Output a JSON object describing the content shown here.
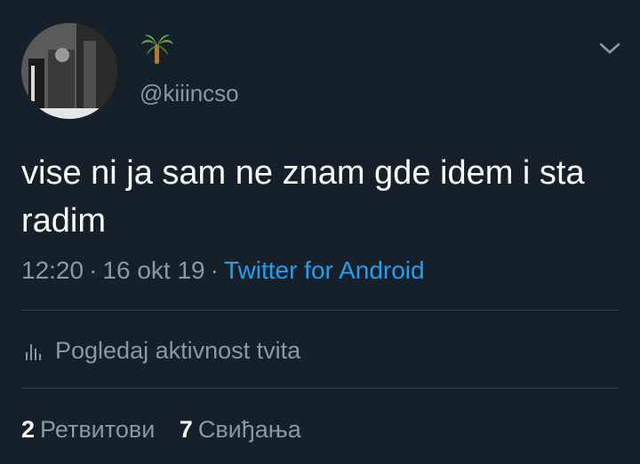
{
  "profile": {
    "display_name_emoji": "🌴",
    "handle": "@kiiincso"
  },
  "tweet": {
    "text": "vise ni ja sam ne znam gde idem i sta radim",
    "time": "12:20",
    "date": "16 okt 19",
    "separator": "·",
    "source": "Twitter for Android"
  },
  "activity": {
    "label": "Pogledaj aktivnost tvita",
    "icon": "bar-chart-icon"
  },
  "stats": {
    "retweets_count": "2",
    "retweets_label": "Ретвитови",
    "likes_count": "7",
    "likes_label": "Свиђања"
  },
  "colors": {
    "background": "#15202b",
    "text": "#ffffff",
    "secondary": "#8899a6",
    "link": "#1da1f2",
    "divider": "#38444d"
  }
}
